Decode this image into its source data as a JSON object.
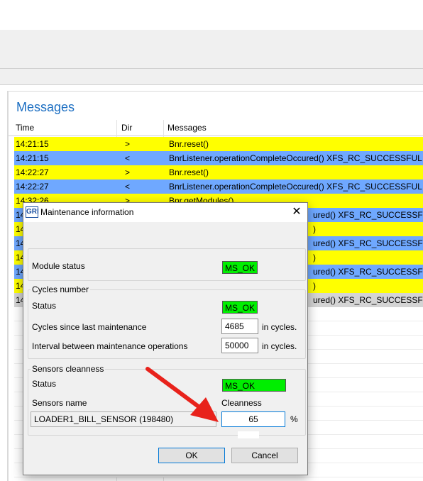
{
  "messages_panel": {
    "title": "Messages",
    "columns": [
      "Time",
      "Dir",
      "Messages"
    ],
    "rows": [
      {
        "time": "14:21:15",
        "dir": ">",
        "message": "Bnr.reset()",
        "color": "yellow"
      },
      {
        "time": "14:21:15",
        "dir": "<",
        "message": "BnrListener.operationCompleteOccured() XFS_RC_SUCCESSFUL",
        "color": "blue"
      },
      {
        "time": "14:22:27",
        "dir": ">",
        "message": "Bnr.reset()",
        "color": "yellow"
      },
      {
        "time": "14:22:27",
        "dir": "<",
        "message": "BnrListener.operationCompleteOccured() XFS_RC_SUCCESSFUL",
        "color": "blue"
      },
      {
        "time": "14:32:26",
        "dir": ">",
        "message": "Bnr.getModules()",
        "color": "yellow"
      },
      {
        "time": "14",
        "dir": "",
        "message": "ured() XFS_RC_SUCCESSFUL",
        "color": "blue"
      },
      {
        "time": "14",
        "dir": "",
        "message": ")",
        "color": "yellow"
      },
      {
        "time": "14",
        "dir": "",
        "message": "ured() XFS_RC_SUCCESSFUL",
        "color": "blue"
      },
      {
        "time": "14",
        "dir": "",
        "message": ")",
        "color": "yellow"
      },
      {
        "time": "14",
        "dir": "",
        "message": "ured() XFS_RC_SUCCESSFUL",
        "color": "blue"
      },
      {
        "time": "14",
        "dir": "",
        "message": ")",
        "color": "yellow"
      },
      {
        "time": "14",
        "dir": "",
        "message": "ured() XFS_RC_SUCCESSFUL",
        "color": "gray"
      }
    ]
  },
  "dialog": {
    "icon_text": "GRI",
    "title": "Maintenance information",
    "close_glyph": "✕",
    "module_status_label": "Module status",
    "module_status_value": "MS_OK",
    "cycles_group_label": "Cycles number",
    "cycles_status_label": "Status",
    "cycles_status_value": "MS_OK",
    "cycles_since_label": "Cycles since last maintenance",
    "cycles_since_value": "4685",
    "interval_label": "Interval between maintenance operations",
    "interval_value": "50000",
    "cycles_unit": "in cycles.",
    "sensors_group_label": "Sensors cleanness",
    "sensors_status_label": "Status",
    "sensors_status_value": "MS_OK",
    "sensors_name_label": "Sensors name",
    "cleanness_label": "Cleanness",
    "sensor_name_value": "LOADER1_BILL_SENSOR (198480)",
    "cleanness_value": "65",
    "percent_unit": "%",
    "ok_label": "OK",
    "cancel_label": "Cancel"
  },
  "colors": {
    "highlight_yellow": "#ffff00",
    "highlight_blue": "#6fa8ff",
    "status_green": "#00ee00",
    "annotation_arrow": "#e8221b",
    "title_blue": "#1b6ec2"
  }
}
